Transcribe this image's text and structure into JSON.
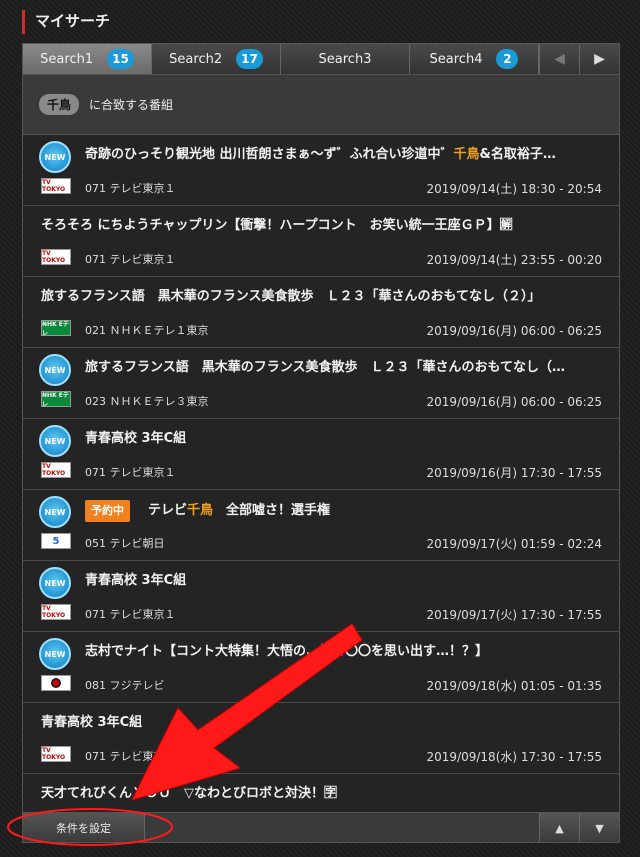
{
  "header": {
    "title": "マイサーチ"
  },
  "tabs": [
    {
      "label": "Search1",
      "badge": "15",
      "active": true
    },
    {
      "label": "Search2",
      "badge": "17"
    },
    {
      "label": "Search3",
      "badge": ""
    },
    {
      "label": "Search4",
      "badge": "2"
    }
  ],
  "match": {
    "keyword": "千鳥",
    "suffix": "に合致する番組"
  },
  "programs": [
    {
      "new": true,
      "reserved": false,
      "title_pre": "奇跡のひっそり観光地 出川哲朗さまぁ～ず゛ふれ合い珍道中゛",
      "title_hl": "千鳥",
      "title_post": "&名取裕子…",
      "channel": "071 テレビ東京１",
      "logo": "tvtokyo",
      "time": "2019/09/14(土) 18:30 - 20:54"
    },
    {
      "new": false,
      "reserved": false,
      "title_pre": "そろそろ にちようチャップリン【衝撃！ハープコント　お笑い統一王座ＧＰ】",
      "title_hl": "",
      "title_post": "🈖",
      "channel": "071 テレビ東京１",
      "logo": "tvtokyo",
      "time": "2019/09/14(土) 23:55 - 00:20"
    },
    {
      "new": false,
      "reserved": false,
      "title_pre": "旅するフランス語　黒木華のフランス美食散歩　Ｌ２３「華さんのおもてなし（２）」",
      "title_hl": "",
      "title_post": "",
      "channel": "021 ＮＨＫＥテレ１東京",
      "logo": "nhk",
      "time": "2019/09/16(月) 06:00 - 06:25"
    },
    {
      "new": true,
      "reserved": false,
      "title_pre": "旅するフランス語　黒木華のフランス美食散歩　Ｌ２３「華さんのおもてなし（…",
      "title_hl": "",
      "title_post": "",
      "channel": "023 ＮＨＫＥテレ３東京",
      "logo": "nhk",
      "time": "2019/09/16(月) 06:00 - 06:25"
    },
    {
      "new": true,
      "reserved": false,
      "title_pre": "青春高校 3年C組",
      "title_hl": "",
      "title_post": "",
      "channel": "071 テレビ東京１",
      "logo": "tvtokyo",
      "time": "2019/09/16(月) 17:30 - 17:55"
    },
    {
      "new": true,
      "reserved": true,
      "reserved_label": "予約中",
      "title_pre": "テレビ",
      "title_hl": "千鳥",
      "title_post": "　全部嘘さ！選手権",
      "channel": "051 テレビ朝日",
      "logo": "asahi",
      "time": "2019/09/17(火) 01:59 - 02:24"
    },
    {
      "new": true,
      "reserved": false,
      "title_pre": "青春高校 3年C組",
      "title_hl": "",
      "title_post": "",
      "channel": "071 テレビ東京１",
      "logo": "tvtokyo",
      "time": "2019/09/17(火) 17:30 - 17:55"
    },
    {
      "new": true,
      "reserved": false,
      "title_pre": "志村でナイト【コント大特集！大悟の…見て〇〇を思い出す…！？】",
      "title_hl": "",
      "title_post": "",
      "channel": "081 フジテレビ",
      "logo": "fuji",
      "time": "2019/09/18(水) 01:05 - 01:35"
    },
    {
      "new": false,
      "reserved": false,
      "title_pre": "青春高校 3年C組",
      "title_hl": "",
      "title_post": "",
      "channel": "071 テレビ東京１",
      "logo": "tvtokyo",
      "time": "2019/09/18(水) 17:30 - 17:55"
    },
    {
      "new": false,
      "reserved": false,
      "title_pre": "天才てれびくんＹＯＵ　▽なわとびロボと対決！",
      "title_hl": "",
      "title_post": "🈑",
      "channel": "",
      "logo": "",
      "time": ""
    }
  ],
  "footer": {
    "condition_label": "条件を設定"
  },
  "logos": {
    "tvtokyo": "TV TOKYO",
    "nhk": "NHK Eテレ",
    "asahi": "5"
  },
  "new_label": "NEW",
  "colors": {
    "accent": "#d62b2b",
    "badge": "#1a9ad6",
    "highlight": "#f0a020",
    "reserved": "#f08020",
    "annotation": "#ff1a1a"
  }
}
